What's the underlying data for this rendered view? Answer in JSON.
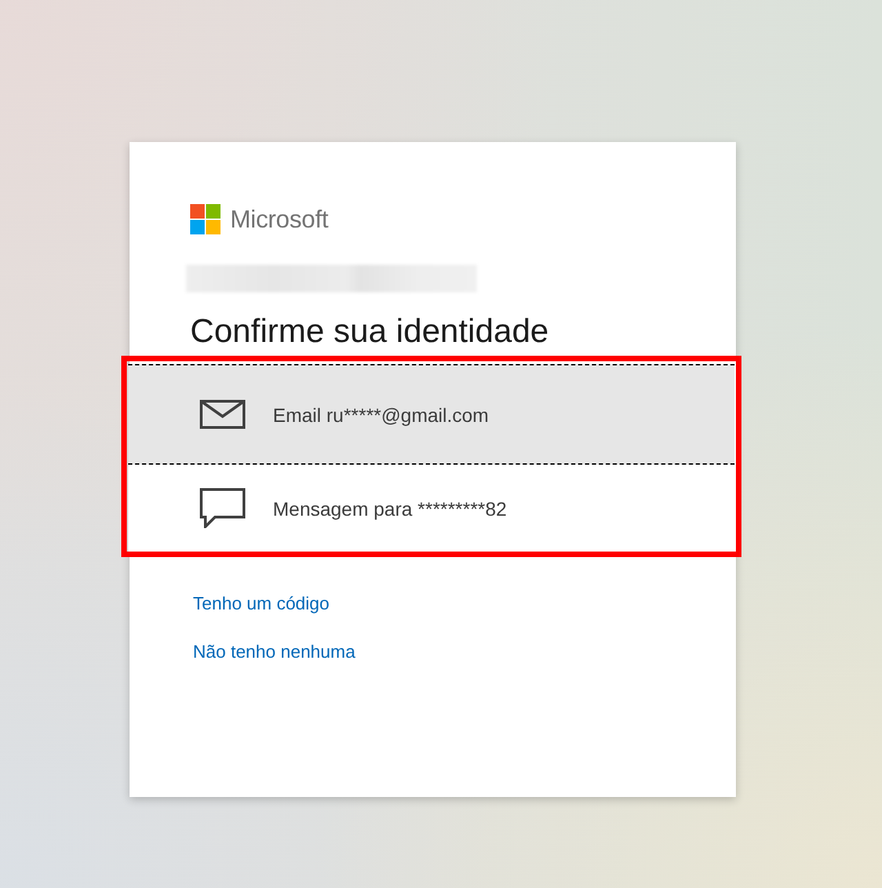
{
  "brand": {
    "name": "Microsoft"
  },
  "heading": "Confirme sua identidade",
  "options": [
    {
      "kind": "email",
      "label": "Email ru*****@gmail.com",
      "selected": true
    },
    {
      "kind": "sms",
      "label": "Mensagem para *********82",
      "selected": false
    }
  ],
  "links": [
    {
      "label": "Tenho um código"
    },
    {
      "label": "Não tenho nenhuma"
    }
  ]
}
